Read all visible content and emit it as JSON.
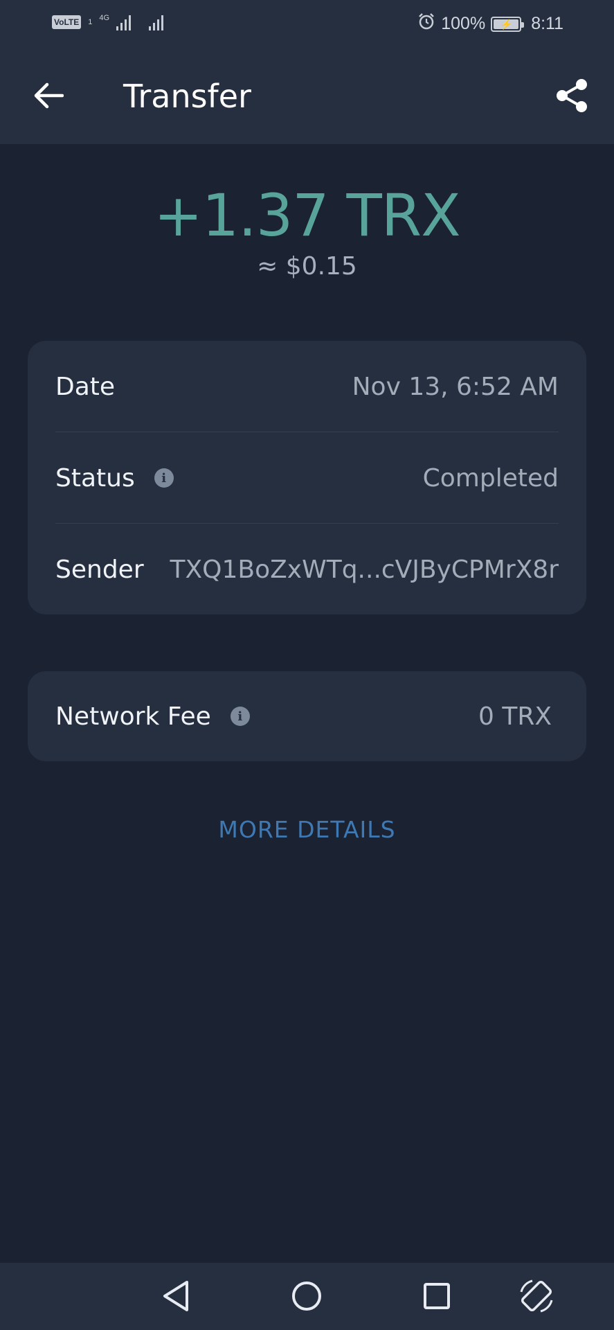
{
  "status_bar": {
    "volte": "VoLTE",
    "sim_number": "1",
    "network": "4G",
    "battery_percent": "100%",
    "time": "8:11",
    "icons": [
      "signal-bars-icon",
      "alarm-icon",
      "battery-icon"
    ]
  },
  "app_bar": {
    "title": "Transfer",
    "icons": [
      "back-arrow-icon",
      "share-icon"
    ]
  },
  "amount": {
    "value": "+1.37 TRX",
    "fiat": "≈ $0.15",
    "color": "#58a49b"
  },
  "details": {
    "rows": [
      {
        "label": "Date",
        "value": "Nov 13, 6:52 AM",
        "has_info": false
      },
      {
        "label": "Status",
        "value": "Completed",
        "has_info": true
      },
      {
        "label": "Sender",
        "value": "TXQ1BoZxWTq...cVJByCPMrX8r",
        "has_info": false
      }
    ]
  },
  "fee": {
    "label": "Network Fee",
    "value": "0 TRX"
  },
  "more_details_label": "MORE DETAILS",
  "nav_bar": {
    "icons": [
      "back-triangle-icon",
      "home-circle-icon",
      "recents-square-icon",
      "rotate-screen-icon"
    ]
  },
  "colors": {
    "background": "#1b2232",
    "card": "#252f3f",
    "accent_link": "#3f79b3"
  }
}
